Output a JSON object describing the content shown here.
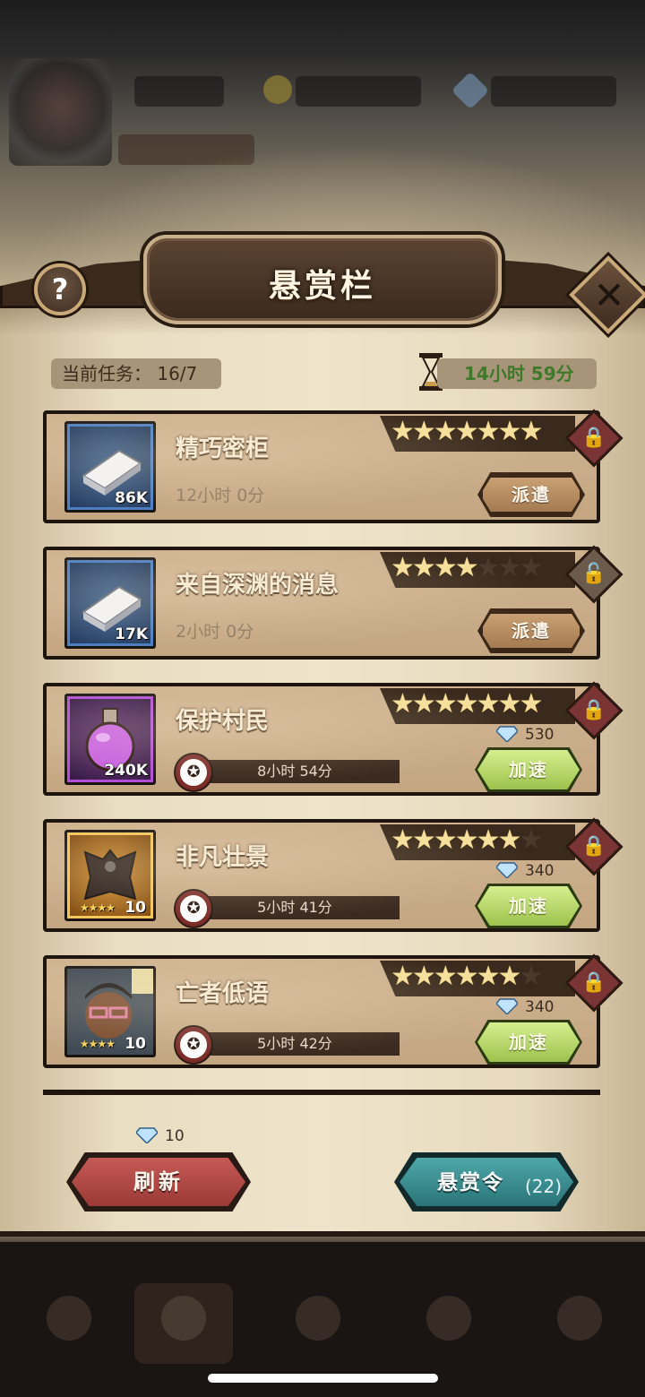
{
  "header": {
    "title": "悬赏栏",
    "help_label": "?",
    "close_label": "✕"
  },
  "status": {
    "current_tasks": "当前任务： 16/7",
    "timer": "14小时 59分"
  },
  "tasks": [
    {
      "title": "精巧密柜",
      "thumb_count": "86K",
      "stars": 7,
      "max_stars": 7,
      "duration": "12小时 0分",
      "action": "派遣",
      "locked": true
    },
    {
      "title": "来自深渊的消息",
      "thumb_count": "17K",
      "stars": 4,
      "max_stars": 7,
      "duration": "2小时 0分",
      "action": "派遣",
      "locked": false
    },
    {
      "title": "保护村民",
      "thumb_count": "240K",
      "stars": 7,
      "max_stars": 7,
      "remaining": "8小时 54分",
      "action": "加速",
      "cost": "530",
      "locked": true
    },
    {
      "title": "非凡壮景",
      "thumb_level": "10",
      "thumb_stars": "★★★★",
      "stars": 6,
      "max_stars": 7,
      "remaining": "5小时 41分",
      "action": "加速",
      "cost": "340",
      "locked": true
    },
    {
      "title": "亡者低语",
      "thumb_level": "10",
      "thumb_stars": "★★★★",
      "stars": 6,
      "max_stars": 7,
      "remaining": "5小时 42分",
      "action": "加速",
      "cost": "340",
      "locked": true
    }
  ],
  "footer": {
    "refresh_label": "刷新",
    "refresh_cost": "10",
    "bounty_label": "悬赏令",
    "bounty_count": "(22)"
  },
  "icons": {
    "hourglass": "hourglass-icon",
    "gem": "diamond-gem-icon",
    "lock": "padlock-icon",
    "speedup": "clock-badge-icon"
  },
  "colors": {
    "parchment": "#efe4cb",
    "speed_green": "#b5d86b",
    "refresh_red": "#b34a45",
    "bounty_teal": "#3b8f92",
    "timer_green": "#3f7a2a"
  }
}
